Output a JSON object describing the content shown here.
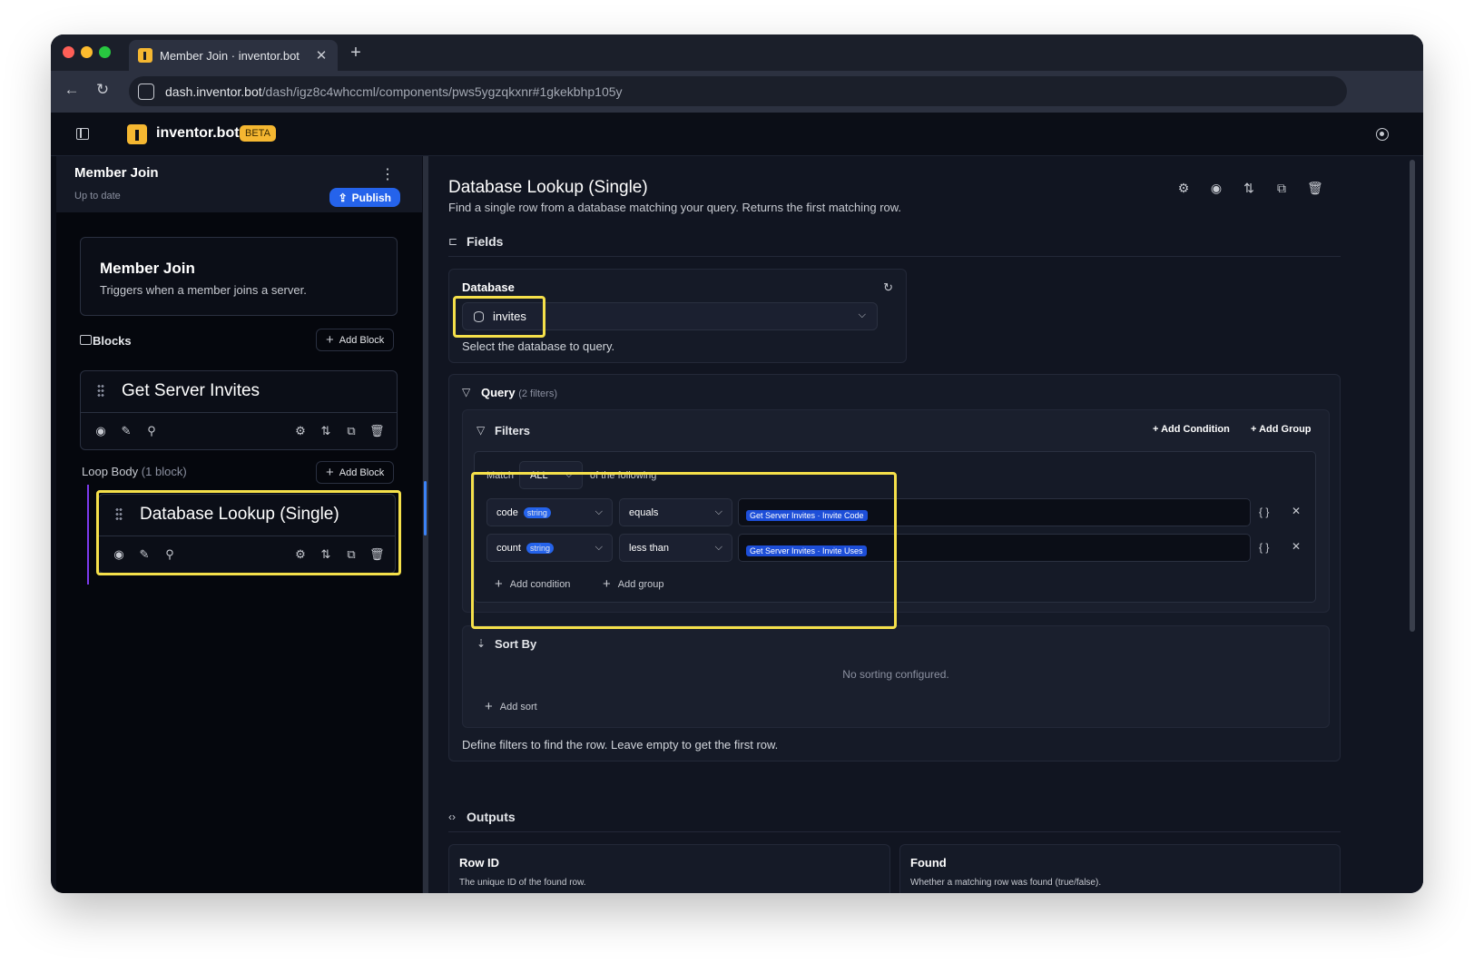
{
  "browser": {
    "tab_title": "Member Join · inventor.bot",
    "url_host": "dash.inventor.bot",
    "url_path": "/dash/igz8c4whccml/components/pws5ygzqkxnr#1gkekbhp105y"
  },
  "app": {
    "brand": "inventor.bot",
    "badge": "BETA"
  },
  "sidebar": {
    "title": "Member Join",
    "status": "Up to date",
    "publish_label": "Publish",
    "trigger": {
      "title": "Member Join",
      "description": "Triggers when a member joins a server."
    },
    "blocks_label": "Blocks",
    "add_block_label": "Add Block",
    "blocks": [
      {
        "title": "Get Server Invites"
      }
    ],
    "loop_body": {
      "label": "Loop Body",
      "count": "(1 block)",
      "add_block_label": "Add Block",
      "blocks": [
        {
          "title": "Database Lookup (Single)"
        }
      ]
    }
  },
  "main": {
    "title": "Database Lookup (Single)",
    "description": "Find a single row from a database matching your query. Returns the first matching row.",
    "fields_label": "Fields",
    "database": {
      "label": "Database",
      "value": "invites",
      "help": "Select the database to query."
    },
    "query": {
      "label": "Query",
      "count": "(2 filters)",
      "filters_label": "Filters",
      "add_condition_label": "+ Add Condition",
      "add_group_label": "+ Add Group",
      "match_label": "Match",
      "match_value": "ALL",
      "match_suffix": "of the following",
      "conditions": [
        {
          "field": "code",
          "type": "string",
          "operator": "equals",
          "value": "Get Server Invites · Invite Code"
        },
        {
          "field": "count",
          "type": "string",
          "operator": "less than",
          "value": "Get Server Invites · Invite Uses"
        }
      ],
      "add_condition_inline": "Add condition",
      "add_group_inline": "Add group",
      "sort_label": "Sort By",
      "sort_empty": "No sorting configured.",
      "add_sort_label": "Add sort",
      "help": "Define filters to find the row. Leave empty to get the first row."
    },
    "outputs_label": "Outputs",
    "outputs": [
      {
        "title": "Row ID",
        "description": "The unique ID of the found row."
      },
      {
        "title": "Found",
        "description": "Whether a matching row was found (true/false)."
      }
    ]
  },
  "colors": {
    "accent": "#2563eb",
    "brand": "#f5b731",
    "highlight": "#f5e04a",
    "loop_line": "#7c3aed"
  }
}
